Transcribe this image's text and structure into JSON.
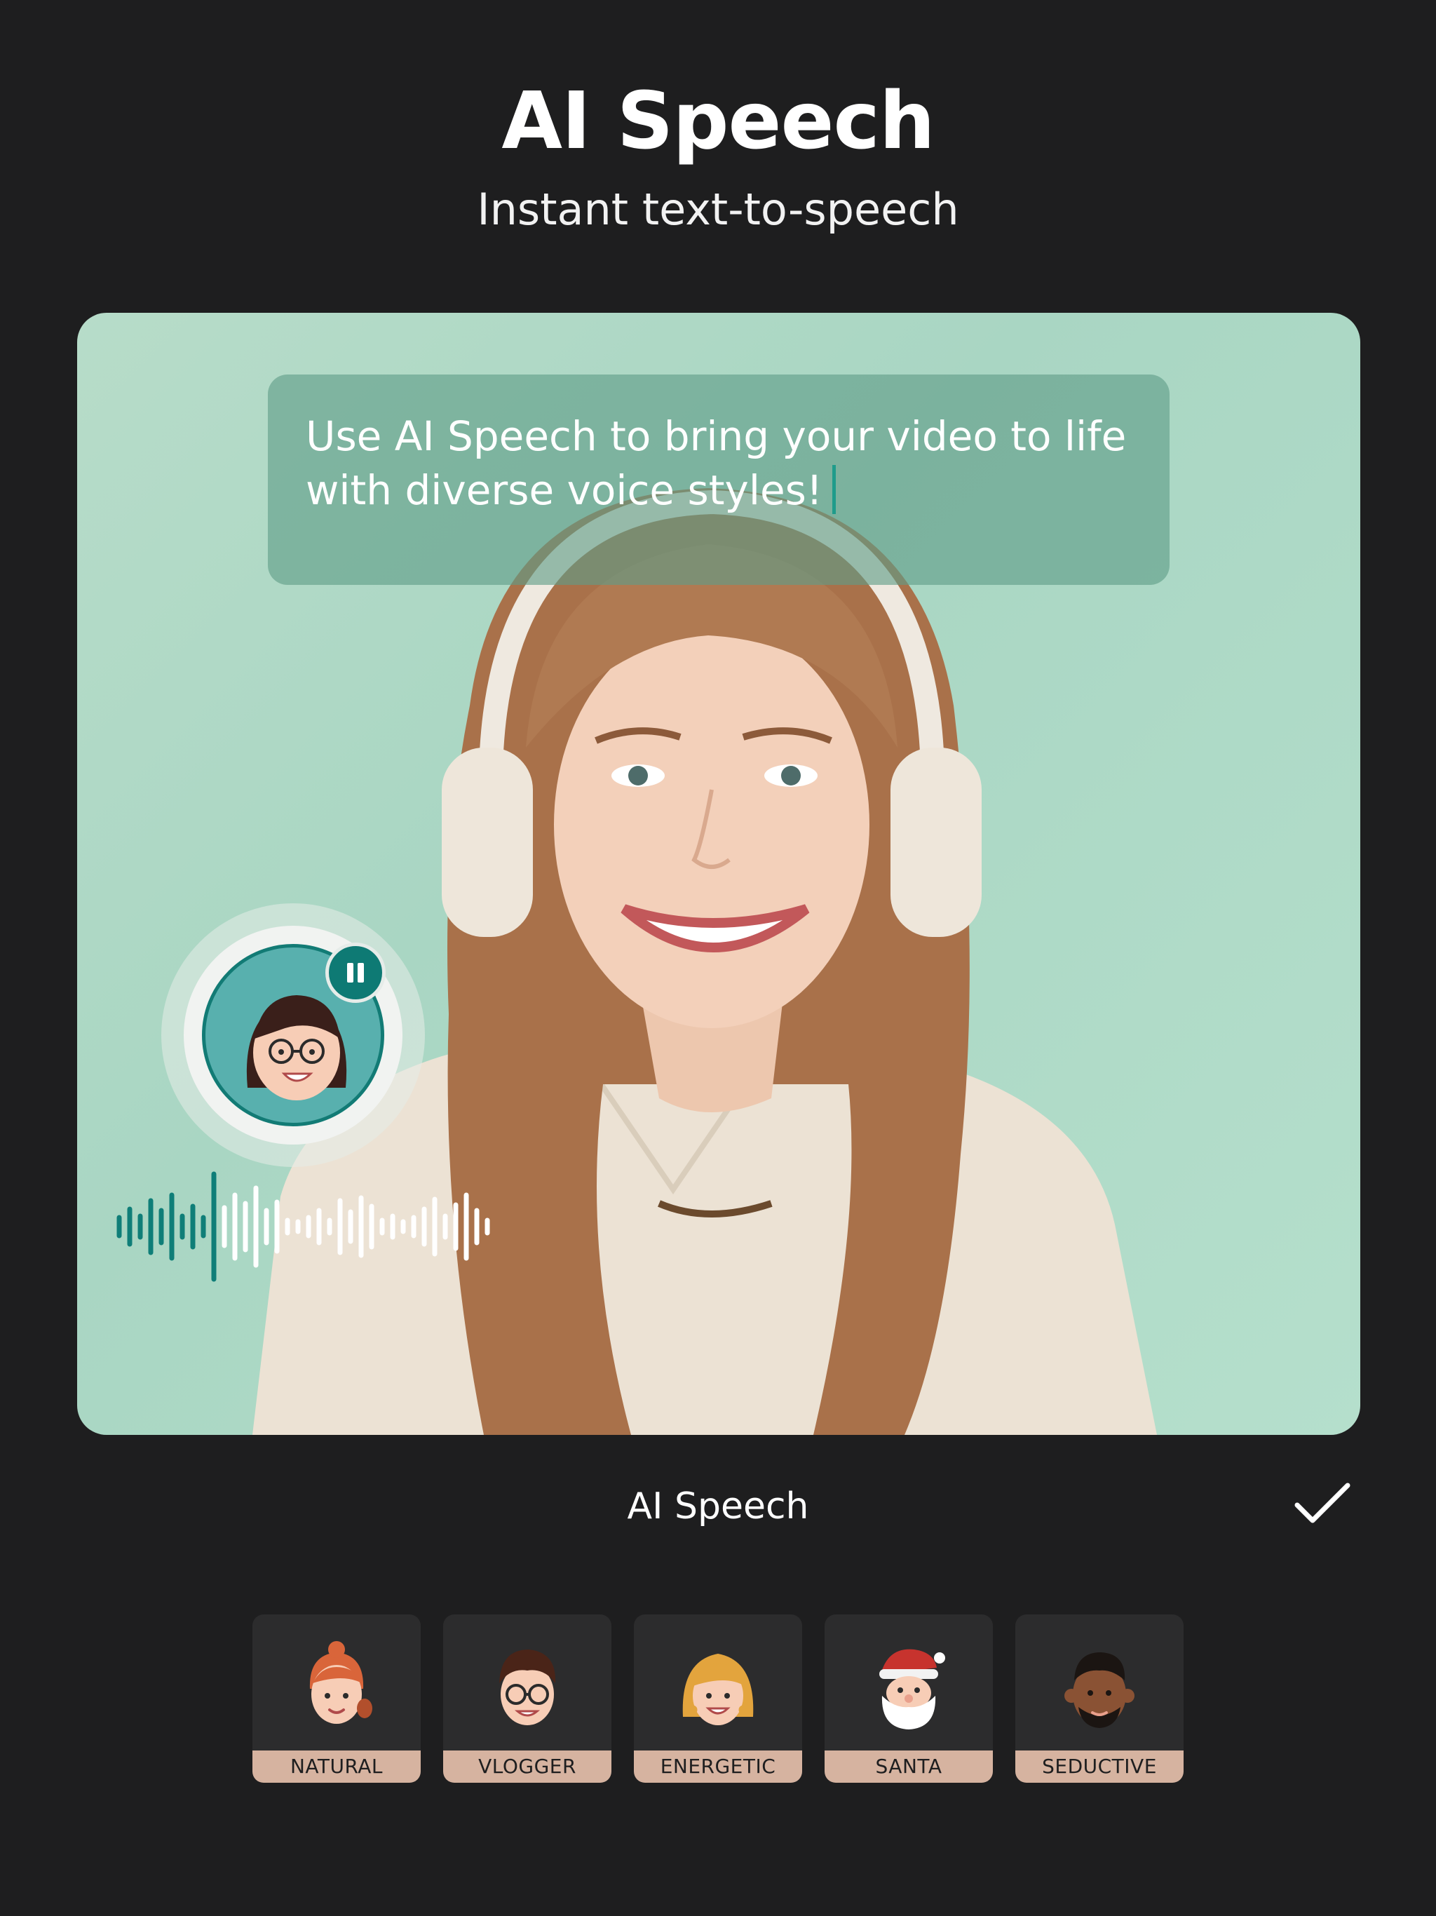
{
  "header": {
    "title": "AI Speech",
    "subtitle": "Instant text-to-speech"
  },
  "preview": {
    "bubble_text": "Use AI Speech to bring your video to life\nwith diverse voice styles!",
    "pause_icon": "pause-icon",
    "avatar_icon": "woman-glasses-avatar-icon"
  },
  "toolbar": {
    "title": "AI Speech",
    "confirm_icon": "checkmark-icon"
  },
  "voices": [
    {
      "label": "NATURAL",
      "icon": "natural-voice-icon"
    },
    {
      "label": "VLOGGER",
      "icon": "vlogger-voice-icon"
    },
    {
      "label": "ENERGETIC",
      "icon": "energetic-voice-icon"
    },
    {
      "label": "SANTA",
      "icon": "santa-voice-icon"
    },
    {
      "label": "SEDUCTIVE",
      "icon": "seductive-voice-icon"
    }
  ],
  "colors": {
    "background": "#1e1e1f",
    "accent_teal": "#0e7a74",
    "label_tan": "#d6b3a0",
    "hero_bg": "#b7dcc9"
  }
}
